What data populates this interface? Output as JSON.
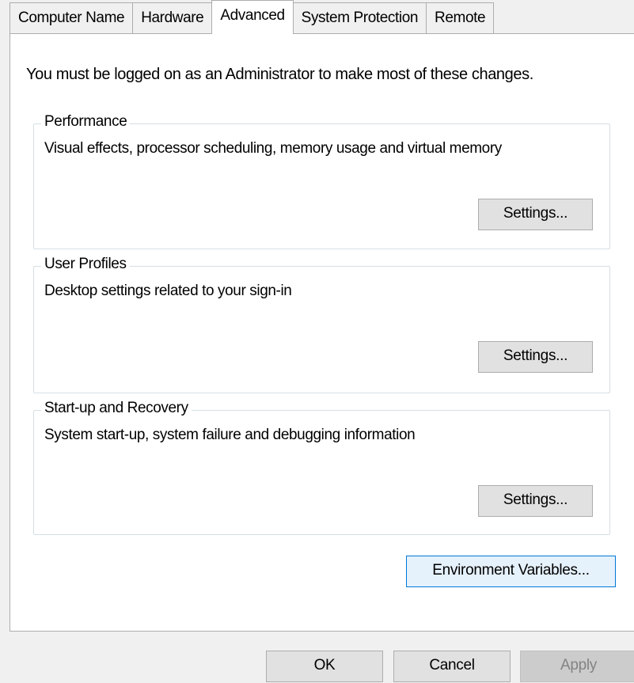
{
  "tabs": [
    {
      "label": "Computer Name",
      "active": false
    },
    {
      "label": "Hardware",
      "active": false
    },
    {
      "label": "Advanced",
      "active": true
    },
    {
      "label": "System Protection",
      "active": false
    },
    {
      "label": "Remote",
      "active": false
    }
  ],
  "notice": "You must be logged on as an Administrator to make most of these changes.",
  "groups": {
    "performance": {
      "title": "Performance",
      "description": "Visual effects, processor scheduling, memory usage and virtual memory",
      "button": "Settings..."
    },
    "user_profiles": {
      "title": "User Profiles",
      "description": "Desktop settings related to your sign-in",
      "button": "Settings..."
    },
    "startup_recovery": {
      "title": "Start-up and Recovery",
      "description": "System start-up, system failure and debugging information",
      "button": "Settings..."
    }
  },
  "environment_button": "Environment Variables...",
  "footer": {
    "ok": "OK",
    "cancel": "Cancel",
    "apply": "Apply",
    "apply_enabled": false
  }
}
